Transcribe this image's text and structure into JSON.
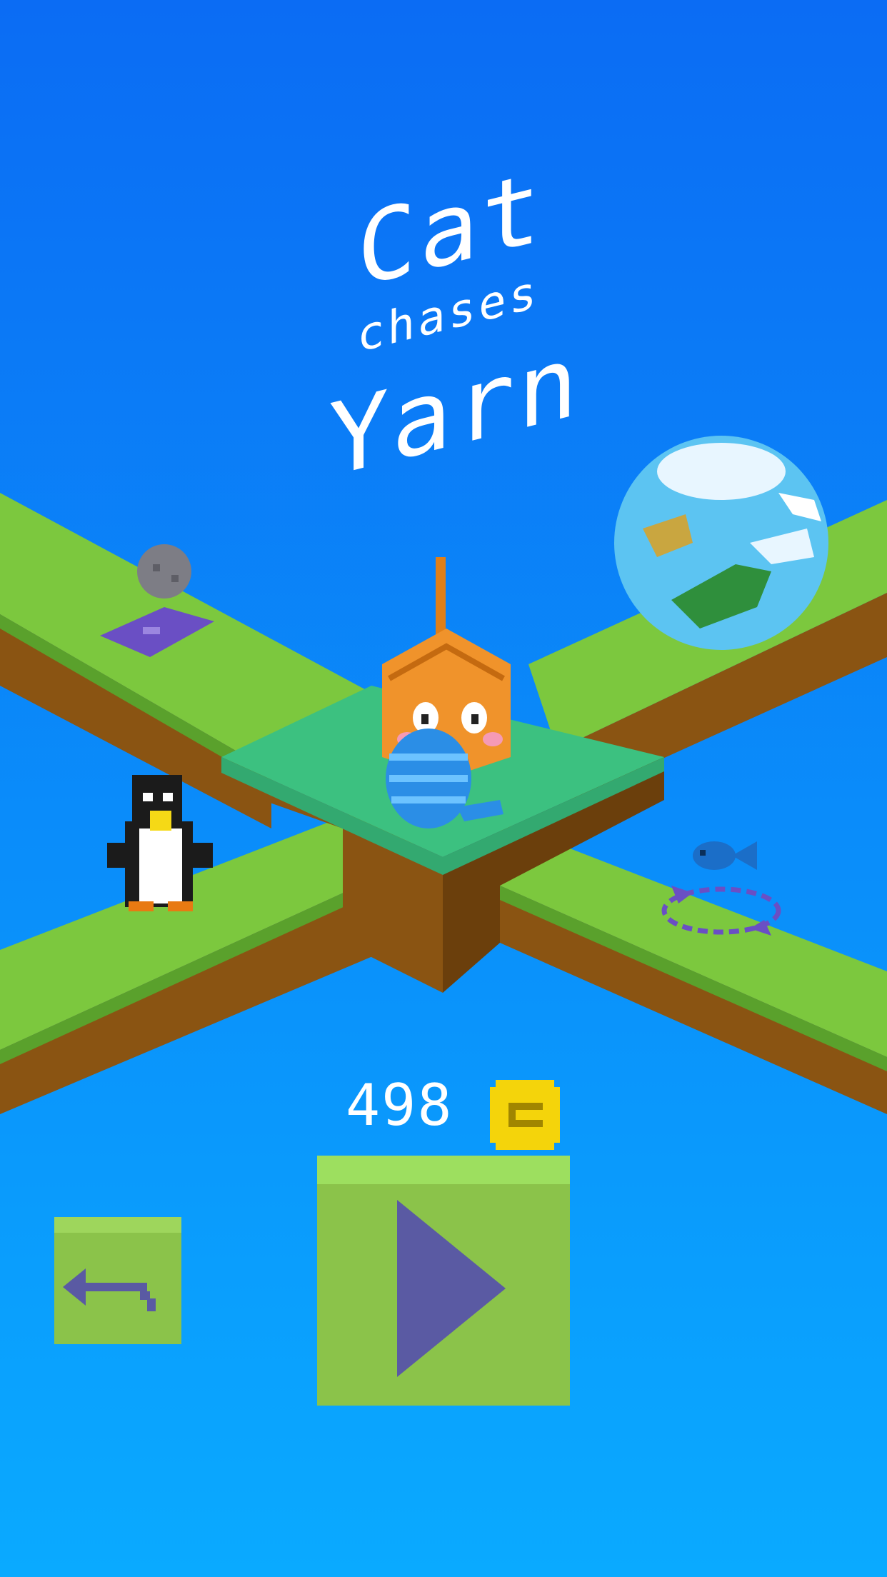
{
  "title": {
    "line1": "Cat",
    "line2": "chases",
    "line3": "Yarn"
  },
  "coins": {
    "count": "498"
  },
  "buttons": {
    "back_icon": "back-arrow-icon",
    "play_icon": "play-triangle-icon"
  },
  "colors": {
    "sky_top": "#0b6cf4",
    "sky_bottom": "#0aa8ff",
    "grass": "#7cc83e",
    "grass_dark": "#5aa12c",
    "dirt": "#8a5412",
    "center_tile": "#3cc180",
    "button_green": "#8bc34a",
    "button_icon": "#5a5aa3",
    "coin": "#f4d40b",
    "title_text": "#ffffff"
  }
}
